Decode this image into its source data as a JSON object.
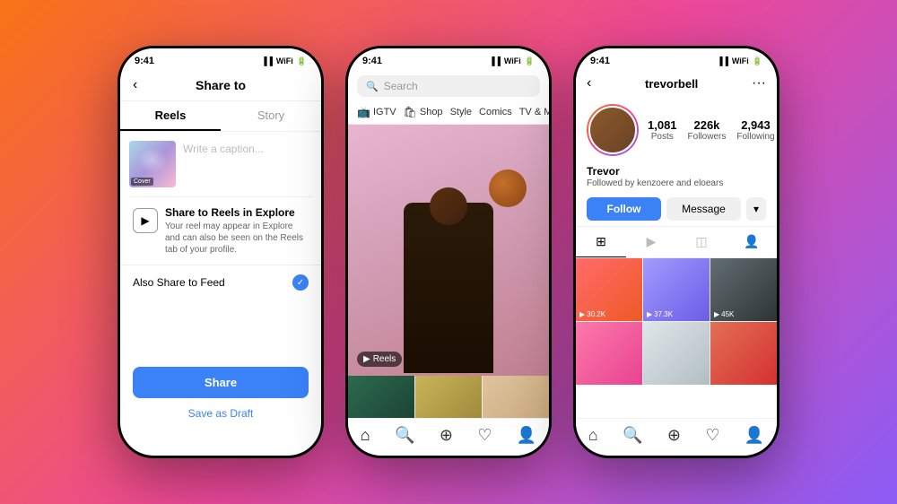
{
  "background": {
    "gradient": "linear-gradient(135deg, #f97316, #ec4899, #8b5cf6)"
  },
  "phone1": {
    "statusTime": "9:41",
    "header": {
      "title": "Share to",
      "backLabel": "‹"
    },
    "tabs": [
      {
        "label": "Reels",
        "active": true
      },
      {
        "label": "Story",
        "active": false
      }
    ],
    "caption": {
      "placeholder": "Write a caption...",
      "coverLabel": "Cover"
    },
    "shareSection": {
      "icon": "▶",
      "title": "Share to Reels in Explore",
      "description": "Your reel may appear in Explore and can also be seen on the Reels tab of your profile."
    },
    "alsoShare": {
      "label": "Also Share to Feed",
      "checked": true
    },
    "shareButton": "Share",
    "draftButton": "Save as Draft"
  },
  "phone2": {
    "statusTime": "9:41",
    "search": {
      "placeholder": "Search",
      "icon": "🔍"
    },
    "categories": [
      {
        "icon": "📺",
        "label": "IGTV"
      },
      {
        "icon": "🛍",
        "label": "Shop"
      },
      {
        "icon": "",
        "label": "Style"
      },
      {
        "icon": "",
        "label": "Comics"
      },
      {
        "icon": "",
        "label": "TV & Movi..."
      }
    ],
    "reelsBadge": "Reels",
    "gridThumbs": [
      "thumb1",
      "thumb2",
      "thumb3",
      "thumb4",
      "thumb5",
      "thumb6"
    ],
    "nav": [
      "🏠",
      "🔍",
      "➕",
      "♡",
      "👤"
    ]
  },
  "phone3": {
    "statusTime": "9:41",
    "username": "trevorbell",
    "dotsMenu": "···",
    "stats": [
      {
        "number": "1,081",
        "label": "Posts"
      },
      {
        "number": "226k",
        "label": "Followers"
      },
      {
        "number": "2,943",
        "label": "Following"
      }
    ],
    "profileName": "Trevor",
    "followedBy": "Followed by kenzoere and eloears",
    "buttons": {
      "follow": "Follow",
      "message": "Message",
      "dropdown": "▾"
    },
    "contentTabs": [
      "⊞",
      "▶",
      "◫",
      "👤"
    ],
    "gridItems": [
      {
        "count": "30.2K"
      },
      {
        "count": "37.3K"
      },
      {
        "count": "45K"
      },
      {
        "count": ""
      },
      {
        "count": ""
      },
      {
        "count": ""
      }
    ],
    "nav": [
      "🏠",
      "🔍",
      "➕",
      "♡",
      "👤"
    ]
  }
}
